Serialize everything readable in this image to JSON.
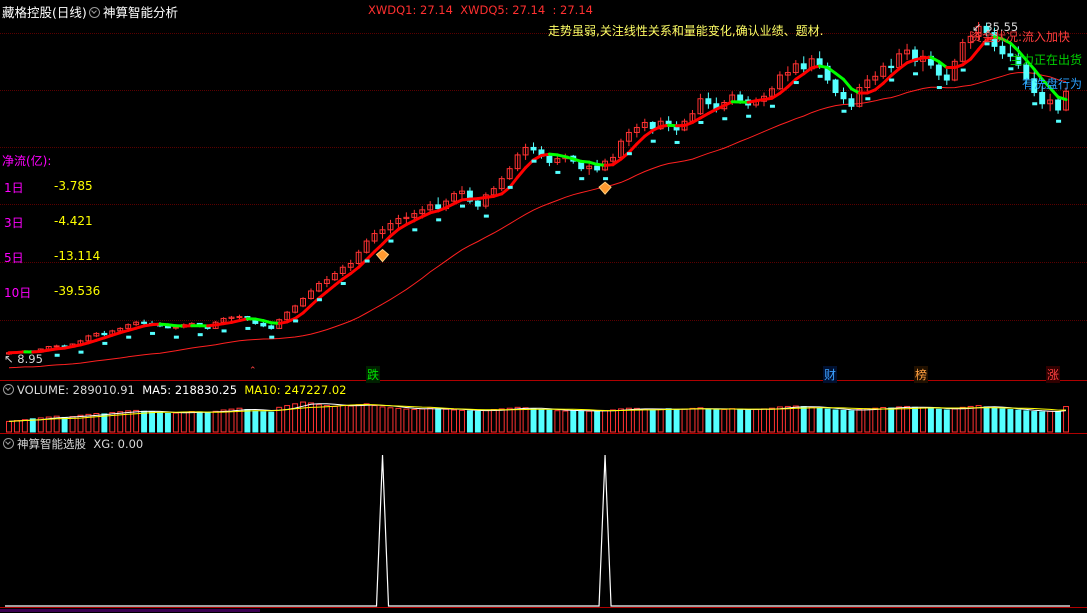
{
  "header": {
    "stock_name": "藏格控股(日线)",
    "indicator_name": "神算智能分析",
    "xwdq1_label": "XWDQ1: 27.14",
    "xwdq5_label": "XWDQ5: 27.14",
    "xwdq_extra": ": 27.14",
    "headline": "走势虽弱,关注线性关系和量能变化,确认业绩、题材."
  },
  "price_panel": {
    "high_label": "35.55",
    "low_label": "8.95",
    "status_lines": [
      "资金状况:流入加快",
      "主力正在出货",
      "有洗盘行为"
    ],
    "status_colors": [
      "#ff3c3c",
      "#00d000",
      "#2aa0ff"
    ],
    "net_flow_title": "净流(亿):",
    "net_flow": [
      {
        "label": "1日",
        "value": "-3.785"
      },
      {
        "label": "3日",
        "value": "-4.421"
      },
      {
        "label": "5日",
        "value": "-13.114"
      },
      {
        "label": "10日",
        "value": "-39.536"
      }
    ]
  },
  "event_tags": [
    {
      "text": "跌",
      "color": "#00e000",
      "bg": "#002000"
    },
    {
      "text": "财",
      "color": "#3aa0ff",
      "bg": "#001030"
    },
    {
      "text": "榜",
      "color": "#ffa040",
      "bg": "#201000"
    },
    {
      "text": "涨",
      "color": "#ff4040",
      "bg": "#300000"
    }
  ],
  "volume_panel": {
    "volume_label": "VOLUME: 289010.91",
    "ma5_label": "MA5: 218830.25",
    "ma10_label": "MA10: 247227.02"
  },
  "selector_panel": {
    "name": "神算智能选股",
    "xg_label": "XG: 0.00"
  },
  "colors": {
    "up": "#ff3232",
    "down": "#54ffff",
    "ma5": "#ffffff",
    "ma10": "#ffff00",
    "trend_up": "#ff0000",
    "trend_down": "#00ff00",
    "grid": "#5a0000",
    "separator": "#b00000",
    "label_magenta": "#ff00ff",
    "value_yellow": "#ffff00"
  },
  "chart_data": {
    "type": "candlestick",
    "price_range": [
      8.95,
      35.55
    ],
    "candles": [
      [
        8.95,
        9.05,
        8.85,
        9.05
      ],
      [
        9.05,
        9.15,
        8.95,
        9.1
      ],
      [
        9.1,
        9.25,
        9.05,
        9.2
      ],
      [
        9.2,
        9.2,
        9.05,
        9.1
      ],
      [
        9.1,
        9.4,
        9.05,
        9.35
      ],
      [
        9.35,
        9.6,
        9.3,
        9.55
      ],
      [
        9.55,
        9.7,
        9.45,
        9.6
      ],
      [
        9.6,
        9.7,
        9.45,
        9.5
      ],
      [
        9.5,
        9.8,
        9.45,
        9.75
      ],
      [
        9.75,
        10.1,
        9.7,
        10.0
      ],
      [
        10.0,
        10.5,
        9.95,
        10.4
      ],
      [
        10.4,
        10.7,
        10.3,
        10.6
      ],
      [
        10.6,
        10.8,
        10.4,
        10.5
      ],
      [
        10.5,
        10.9,
        10.45,
        10.8
      ],
      [
        10.8,
        11.1,
        10.7,
        11.0
      ],
      [
        11.0,
        11.4,
        10.9,
        11.3
      ],
      [
        11.3,
        11.6,
        11.2,
        11.5
      ],
      [
        11.5,
        11.7,
        11.3,
        11.4
      ],
      [
        11.4,
        11.6,
        11.2,
        11.3
      ],
      [
        11.3,
        11.5,
        11.1,
        11.2
      ],
      [
        11.2,
        11.3,
        11.0,
        11.05
      ],
      [
        11.05,
        11.2,
        10.9,
        11.1
      ],
      [
        11.1,
        11.4,
        11.0,
        11.3
      ],
      [
        11.3,
        11.5,
        11.2,
        11.4
      ],
      [
        11.4,
        11.4,
        11.1,
        11.2
      ],
      [
        11.2,
        11.3,
        10.9,
        11.0
      ],
      [
        11.0,
        11.6,
        10.95,
        11.5
      ],
      [
        11.5,
        11.9,
        11.4,
        11.8
      ],
      [
        11.8,
        12.0,
        11.6,
        11.9
      ],
      [
        11.9,
        12.1,
        11.7,
        11.95
      ],
      [
        11.95,
        12.0,
        11.6,
        11.7
      ],
      [
        11.7,
        11.8,
        11.3,
        11.4
      ],
      [
        11.4,
        11.6,
        11.1,
        11.2
      ],
      [
        11.2,
        11.3,
        10.9,
        11.0
      ],
      [
        11.0,
        11.8,
        10.95,
        11.7
      ],
      [
        11.7,
        12.4,
        11.6,
        12.3
      ],
      [
        12.3,
        12.9,
        12.2,
        12.8
      ],
      [
        12.8,
        13.5,
        12.7,
        13.4
      ],
      [
        13.4,
        14.2,
        13.3,
        14.0
      ],
      [
        14.0,
        14.8,
        13.9,
        14.6
      ],
      [
        14.6,
        15.2,
        14.3,
        14.9
      ],
      [
        14.9,
        15.6,
        14.8,
        15.4
      ],
      [
        15.4,
        16.1,
        15.2,
        15.9
      ],
      [
        15.9,
        16.5,
        15.6,
        16.2
      ],
      [
        16.2,
        17.3,
        16.1,
        17.1
      ],
      [
        17.1,
        18.2,
        17.0,
        18.0
      ],
      [
        18.0,
        18.9,
        17.8,
        18.6
      ],
      [
        18.6,
        19.2,
        18.2,
        18.9
      ],
      [
        18.9,
        19.7,
        18.6,
        19.4
      ],
      [
        19.4,
        20.1,
        19.0,
        19.8
      ],
      [
        19.8,
        20.3,
        19.4,
        19.9
      ],
      [
        19.9,
        20.5,
        19.5,
        20.2
      ],
      [
        20.2,
        20.8,
        19.8,
        20.5
      ],
      [
        20.5,
        21.2,
        20.2,
        20.9
      ],
      [
        20.9,
        21.5,
        20.3,
        20.6
      ],
      [
        20.6,
        21.4,
        20.4,
        21.2
      ],
      [
        21.2,
        22.0,
        21.0,
        21.8
      ],
      [
        21.8,
        22.4,
        21.4,
        22.0
      ],
      [
        22.0,
        22.3,
        21.0,
        21.2
      ],
      [
        21.2,
        21.5,
        20.5,
        20.8
      ],
      [
        20.8,
        21.9,
        20.6,
        21.7
      ],
      [
        21.7,
        22.4,
        21.5,
        22.2
      ],
      [
        22.2,
        23.2,
        22.0,
        23.0
      ],
      [
        23.0,
        24.0,
        22.9,
        23.8
      ],
      [
        23.8,
        25.1,
        23.6,
        24.9
      ],
      [
        24.9,
        25.8,
        24.5,
        25.5
      ],
      [
        25.5,
        25.9,
        25.0,
        25.3
      ],
      [
        25.3,
        25.6,
        24.6,
        24.8
      ],
      [
        24.8,
        25.0,
        24.0,
        24.3
      ],
      [
        24.3,
        24.8,
        24.1,
        24.6
      ],
      [
        24.6,
        25.0,
        24.3,
        24.8
      ],
      [
        24.8,
        24.9,
        24.2,
        24.4
      ],
      [
        24.4,
        24.5,
        23.6,
        23.8
      ],
      [
        23.8,
        24.2,
        23.3,
        24.0
      ],
      [
        24.0,
        24.5,
        23.5,
        23.7
      ],
      [
        23.7,
        24.6,
        23.6,
        24.4
      ],
      [
        24.4,
        25.0,
        24.0,
        24.7
      ],
      [
        24.7,
        26.2,
        24.6,
        26.0
      ],
      [
        26.0,
        27.0,
        25.6,
        26.7
      ],
      [
        26.7,
        27.4,
        26.3,
        27.1
      ],
      [
        27.1,
        27.8,
        26.8,
        27.5
      ],
      [
        27.5,
        27.6,
        26.6,
        27.0
      ],
      [
        27.0,
        27.9,
        26.9,
        27.6
      ],
      [
        27.6,
        28.0,
        26.8,
        27.2
      ],
      [
        27.2,
        27.6,
        26.5,
        26.9
      ],
      [
        26.9,
        27.8,
        26.8,
        27.6
      ],
      [
        27.6,
        28.5,
        27.4,
        28.2
      ],
      [
        28.2,
        29.8,
        28.1,
        29.4
      ],
      [
        29.4,
        29.9,
        28.6,
        29.0
      ],
      [
        29.0,
        29.5,
        28.3,
        28.6
      ],
      [
        28.6,
        29.3,
        28.4,
        29.1
      ],
      [
        29.1,
        30.0,
        28.9,
        29.7
      ],
      [
        29.7,
        30.0,
        29.0,
        29.3
      ],
      [
        29.3,
        29.6,
        28.6,
        28.9
      ],
      [
        28.9,
        29.5,
        28.7,
        29.2
      ],
      [
        29.2,
        29.9,
        28.8,
        29.6
      ],
      [
        29.6,
        30.4,
        29.4,
        30.2
      ],
      [
        30.2,
        31.6,
        30.1,
        31.3
      ],
      [
        31.3,
        32.0,
        30.8,
        31.5
      ],
      [
        31.5,
        32.5,
        31.3,
        32.2
      ],
      [
        32.2,
        32.8,
        31.4,
        31.8
      ],
      [
        31.8,
        32.9,
        31.6,
        32.6
      ],
      [
        32.6,
        33.2,
        31.8,
        32.0
      ],
      [
        32.0,
        32.3,
        30.6,
        30.9
      ],
      [
        30.9,
        31.0,
        29.6,
        29.9
      ],
      [
        29.9,
        30.3,
        29.0,
        29.4
      ],
      [
        29.4,
        29.8,
        28.5,
        28.8
      ],
      [
        28.8,
        30.6,
        28.7,
        30.3
      ],
      [
        30.3,
        31.3,
        30.0,
        30.9
      ],
      [
        30.9,
        31.6,
        30.5,
        31.2
      ],
      [
        31.2,
        32.3,
        31.0,
        32.0
      ],
      [
        32.0,
        32.6,
        31.5,
        31.9
      ],
      [
        31.9,
        33.4,
        31.7,
        33.0
      ],
      [
        33.0,
        33.8,
        32.5,
        33.3
      ],
      [
        33.3,
        33.6,
        32.0,
        32.4
      ],
      [
        32.4,
        33.3,
        31.6,
        32.8
      ],
      [
        32.8,
        33.2,
        31.8,
        32.1
      ],
      [
        32.1,
        32.5,
        30.9,
        31.3
      ],
      [
        31.3,
        31.8,
        30.5,
        30.9
      ],
      [
        30.9,
        32.6,
        30.8,
        32.4
      ],
      [
        32.4,
        34.2,
        32.3,
        33.9
      ],
      [
        33.9,
        34.8,
        33.4,
        34.4
      ],
      [
        34.4,
        35.55,
        34.0,
        35.2
      ],
      [
        35.2,
        35.5,
        34.4,
        34.7
      ],
      [
        34.7,
        35.1,
        33.2,
        33.6
      ],
      [
        33.6,
        34.0,
        32.6,
        33.0
      ],
      [
        33.0,
        33.8,
        32.4,
        32.8
      ],
      [
        32.8,
        33.6,
        31.8,
        32.1
      ],
      [
        32.1,
        32.5,
        30.6,
        31.0
      ],
      [
        31.0,
        31.6,
        29.6,
        29.9
      ],
      [
        29.9,
        30.4,
        28.6,
        29.0
      ],
      [
        29.0,
        29.8,
        28.4,
        29.3
      ],
      [
        29.3,
        29.6,
        28.2,
        28.5
      ],
      [
        28.5,
        30.3,
        28.4,
        30.0
      ]
    ],
    "volume_range": [
      0,
      420000
    ],
    "volumes": [
      120000,
      130000,
      140000,
      150000,
      160000,
      170000,
      180000,
      165000,
      175000,
      190000,
      200000,
      210000,
      205000,
      220000,
      230000,
      240000,
      245000,
      235000,
      228000,
      220000,
      210000,
      215000,
      225000,
      232000,
      228000,
      218000,
      235000,
      250000,
      260000,
      270000,
      255000,
      240000,
      230000,
      225000,
      280000,
      300000,
      320000,
      340000,
      330000,
      310000,
      300000,
      290000,
      305000,
      295000,
      310000,
      320000,
      300000,
      285000,
      275000,
      268000,
      260000,
      255000,
      262000,
      270000,
      265000,
      258000,
      250000,
      245000,
      240000,
      235000,
      245000,
      255000,
      262000,
      270000,
      280000,
      275000,
      265000,
      255000,
      248000,
      242000,
      238000,
      245000,
      240000,
      236000,
      232000,
      244000,
      250000,
      262000,
      270000,
      268000,
      260000,
      252000,
      258000,
      264000,
      255000,
      260000,
      268000,
      275000,
      262000,
      250000,
      256000,
      265000,
      258000,
      250000,
      255000,
      262000,
      270000,
      285000,
      290000,
      295000,
      288000,
      280000,
      270000,
      260000,
      250000,
      245000,
      240000,
      255000,
      265000,
      270000,
      278000,
      272000,
      285000,
      290000,
      280000,
      276000,
      268000,
      258000,
      250000,
      262000,
      280000,
      290000,
      300000,
      285000,
      275000,
      262000,
      255000,
      248000,
      240000,
      232000,
      228000,
      235000,
      230000,
      289010.91
    ],
    "selector": {
      "xg_range": [
        0,
        1
      ],
      "signal_indices": [
        47,
        75
      ]
    }
  }
}
